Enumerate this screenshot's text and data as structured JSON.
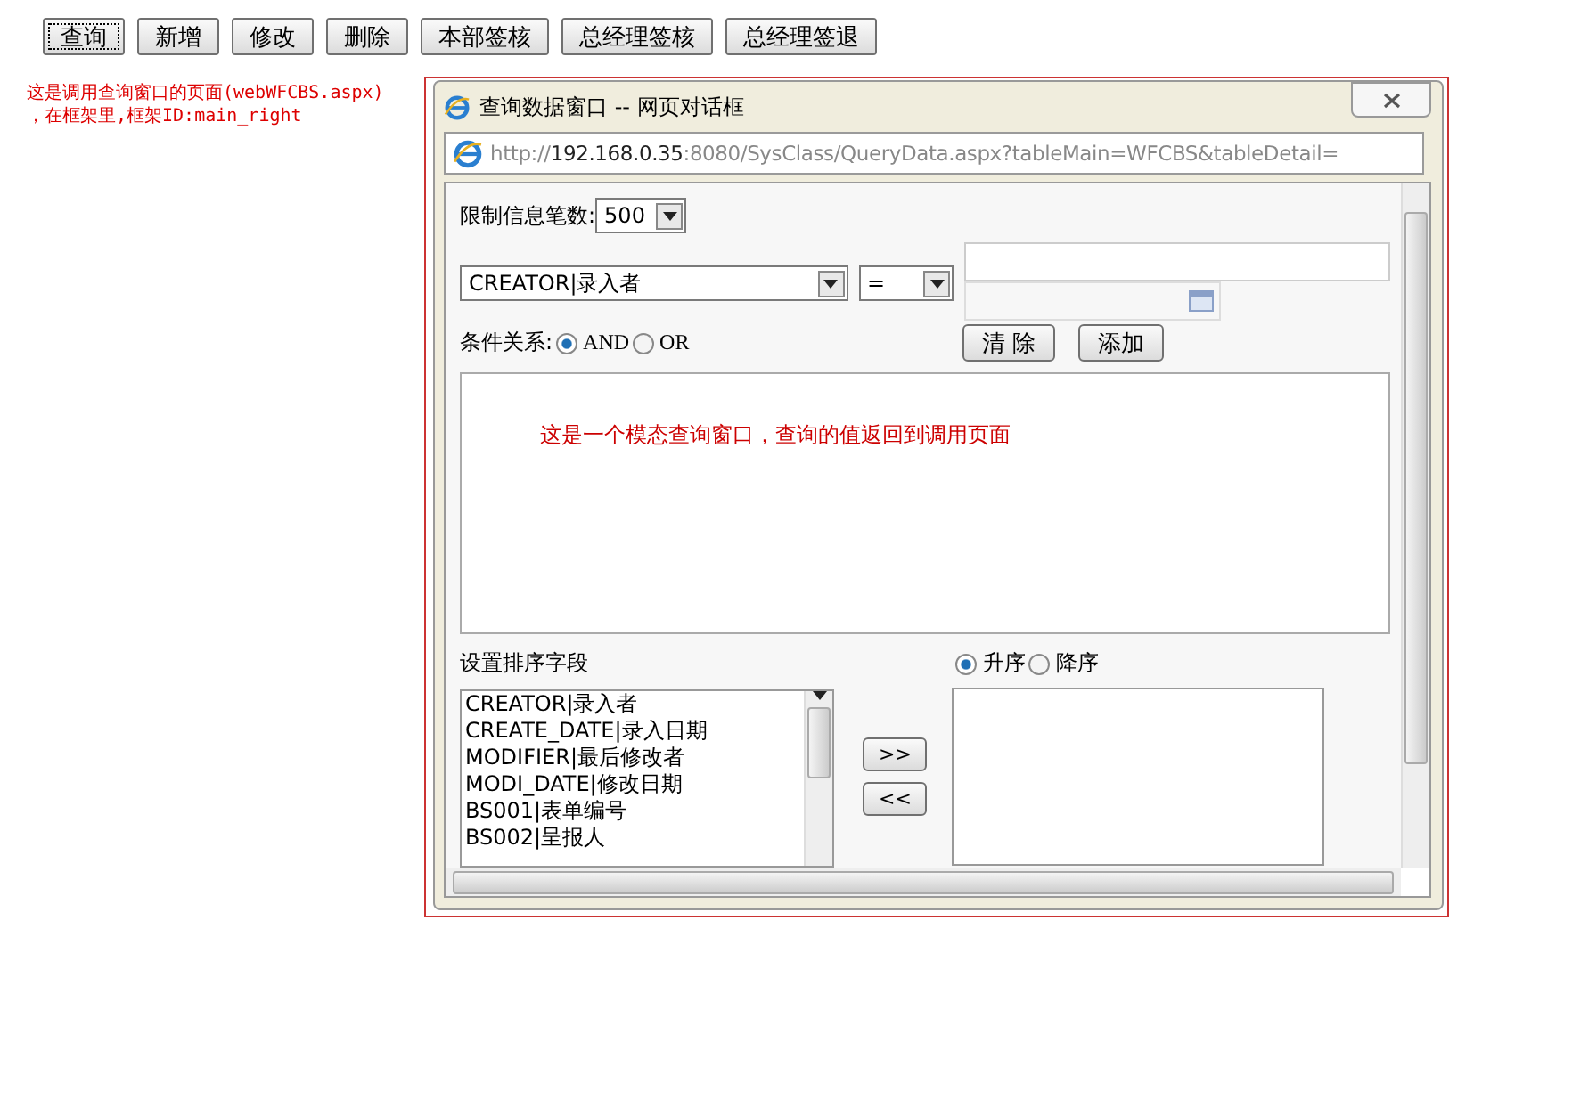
{
  "toolbar": {
    "buttons": [
      {
        "label": "查询",
        "focused": true
      },
      {
        "label": "新增",
        "focused": false
      },
      {
        "label": "修改",
        "focused": false
      },
      {
        "label": "删除",
        "focused": false
      },
      {
        "label": "本部签核",
        "focused": false
      },
      {
        "label": "总经理签核",
        "focused": false
      },
      {
        "label": "总经理签退",
        "focused": false
      }
    ]
  },
  "page_note": {
    "lines": [
      "这是调用查询窗口的页面(webWFCBS.aspx)",
      "，在框架里,框架ID:main_right"
    ]
  },
  "dialog": {
    "title": "查询数据窗口 -- 网页对话框",
    "url": {
      "scheme": "http://",
      "host": "192.168.0.35",
      "path": ":8080/SysClass/QueryData.aspx?tableMain=WFCBS&tableDetail="
    },
    "limit": {
      "label": "限制信息笔数:",
      "value": "500"
    },
    "condition": {
      "field": "CREATOR|录入者",
      "operator": "=",
      "buttons": [
        "清 除",
        "添加"
      ]
    },
    "relation": {
      "label": "条件关系:",
      "options": [
        {
          "label": "AND",
          "selected": true
        },
        {
          "label": "OR",
          "selected": false
        }
      ]
    },
    "query_text": "这是一个模态查询窗口，查询的值返回到调用页面",
    "sort": {
      "label": "设置排序字段",
      "fields": [
        "CREATOR|录入者",
        "CREATE_DATE|录入日期",
        "MODIFIER|最后修改者",
        "MODI_DATE|修改日期",
        "BS001|表单编号",
        "BS002|呈报人"
      ],
      "move_buttons": [
        ">>",
        "<<"
      ],
      "order": [
        {
          "label": "升序",
          "selected": true
        },
        {
          "label": "降序",
          "selected": false
        }
      ]
    }
  }
}
